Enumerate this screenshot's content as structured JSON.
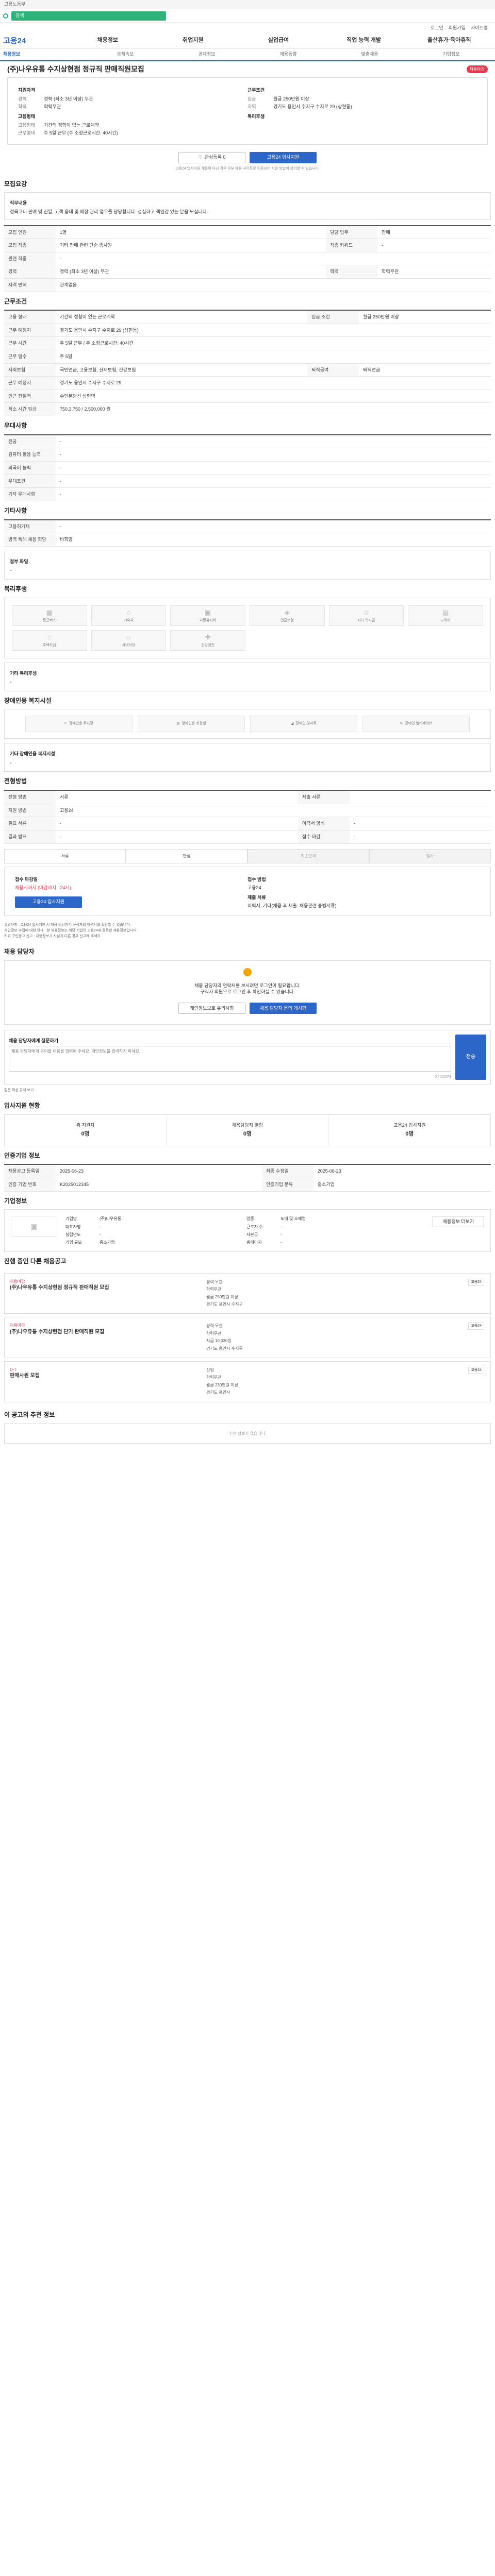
{
  "header": {
    "top_text": "고용노동부",
    "search_text": "검색",
    "util": [
      "로그인",
      "회원가입",
      "사이트맵"
    ],
    "logo": "고용24",
    "gnb": [
      "채용정보",
      "취업지원",
      "실업급여",
      "직업 능력 개발",
      "출산휴가·육아휴직"
    ],
    "subnav": [
      "채용정보",
      "공채속보",
      "공채정보",
      "채용동향",
      "맞춤채용",
      "기업정보"
    ]
  },
  "job": {
    "title": "(주)나우유통 수지상현점 정규직 판매직원모집",
    "badge": "채용마감",
    "left_label": "지원자격",
    "left": [
      {
        "k": "경력",
        "v": "경력 (최소 3년 이상) 무관"
      },
      {
        "k": "학력",
        "v": "학력무관"
      }
    ],
    "left_label2": "고용형태",
    "left2": [
      {
        "k": "고용형태",
        "v": "기간의 정함이 없는 근로계약"
      },
      {
        "k": "근무형태",
        "v": "주 5일 근무 (주 소정근로시간: 40시간)"
      }
    ],
    "right_label": "근무조건",
    "right": [
      {
        "k": "임금",
        "v": "월급 250만원 이상"
      },
      {
        "k": "지역",
        "v": "경기도 용인시 수지구 수지로 29 (상현동)"
      }
    ],
    "right_label2": "복리후생",
    "interest": "관심등록 0",
    "apply_btn": "고용24 입사지원",
    "notice_small": "고용24 입사지원 채용이 아닌 경우 외부 채용 사이트로 이동되어 지원 방법이 상이할 수 있습니다."
  },
  "recruit": {
    "title": "모집요강",
    "desc_label": "직무내용",
    "desc": "정육코너 판매 및 진열, 고객 응대 및 매장 관리 업무를 담당합니다. 성실하고 책임감 있는 분을 모십니다.",
    "rows": [
      [
        "모집 인원",
        "1명",
        "담당 업무",
        "판매"
      ],
      [
        "모집 직종",
        "기타 판매 관련 단순 종사원",
        "직종 키워드",
        "-"
      ],
      [
        "관련 직종",
        "-",
        "",
        ""
      ],
      [
        "경력",
        "경력 (최소 3년 이상) 무관",
        "학력",
        "학력무관"
      ],
      [
        "자격 면허",
        "관계없음",
        "",
        ""
      ]
    ]
  },
  "work": {
    "title": "근무조건",
    "rows": [
      [
        "고용 형태",
        "기간의 정함이 없는 근로계약",
        "임금 조건",
        "월급 250만원 이상"
      ],
      [
        "근무 예정지",
        "경기도 용인시 수지구 수지로 29 (상현동)",
        "",
        ""
      ],
      [
        "근무 시간",
        "주 5일 근무 / 주 소정근로시간: 40시간",
        "",
        ""
      ],
      [
        "근무 일수",
        "주 5일",
        "",
        ""
      ],
      [
        "사회보험",
        "국민연금, 고용보험, 산재보험, 건강보험",
        "퇴직급여",
        "퇴직연금"
      ],
      [
        "근무 예정지",
        "경기도 용인시 수지구 수지로 29",
        "",
        ""
      ],
      [
        "인근 전철역",
        "수인분당선 상현역",
        "",
        ""
      ],
      [
        "최소 시간 임금",
        "750,3,750 / 2,500,000 원",
        "",
        ""
      ]
    ]
  },
  "prefer": {
    "title": "우대사항",
    "rows": [
      [
        "전공",
        "-"
      ],
      [
        "컴퓨터 활용 능력",
        "-"
      ],
      [
        "외국어 능력",
        "-"
      ],
      [
        "우대조건",
        "-"
      ],
      [
        "기타 우대사항",
        "-"
      ]
    ]
  },
  "etc": {
    "title": "기타사항",
    "rows": [
      [
        "고용허가제",
        "-"
      ],
      [
        "병역 특례 채용 희망",
        "비희망"
      ]
    ],
    "attach": "첨부 파일",
    "attach_v": "-"
  },
  "welfare": {
    "title": "복리후생",
    "items": [
      "통근버스",
      "기숙사",
      "차량유지비",
      "연금보험",
      "자녀 학자금",
      "교육비",
      "주택자금",
      "사내식당",
      "건강검진"
    ],
    "other_label": "기타 복리후생",
    "other": "-"
  },
  "disability": {
    "title": "장애인용 복지시설",
    "items": [
      "장애인용 주차장",
      "장애인용 화장실",
      "장애인 경사로",
      "장애인 엘리베이터"
    ],
    "other_label": "기타 장애인용 복지시설",
    "other": "-"
  },
  "apply_method": {
    "title": "전형방법",
    "rows": [
      [
        "전형 방법",
        "서류",
        "제출 서류",
        ""
      ],
      [
        "지원 방법",
        "고용24",
        "",
        ""
      ],
      [
        "필요 서류",
        "-",
        "이력서 양식",
        "-"
      ],
      [
        "결과 발표",
        "-",
        "접수 마감",
        "-"
      ]
    ],
    "steps": [
      "서류",
      "면접",
      "최종합격",
      "입사"
    ],
    "deadline_label": "접수 마감일",
    "deadline": "채용시까지 (마감까지 : 24시)",
    "method_label": "접수 방법",
    "method": "고용24",
    "apply_btn": "고용24 입사지원",
    "docs_label": "제출 서류",
    "docs": "이력서, 기타(채용 후 제출: 채용관련 증빙서류)",
    "notes": [
      "유의사항 : 고용24 입사지원 시 채용 담당자가 구직자의 이력서를 확인할 수 있습니다.",
      "개인정보 수집에 대한 안내 : 본 채용정보는 해당 기업이 고용24에 등록한 채용정보입니다.",
      "허위 구인광고 신고 : 채용정보가 사실과 다른 경우 신고해 주세요."
    ]
  },
  "manager": {
    "title": "채용 담당자",
    "msg1": "채용 담당자의 연락처를 보시려면 로그인이 필요합니다.",
    "msg2": "구직자 회원으로 로그인 후 확인하실 수 있습니다.",
    "btn1": "개인정보보호 유의사항",
    "btn2": "채용 담당자 문의 게시판"
  },
  "inquiry": {
    "title": "채용 담당자에게 질문하기",
    "placeholder": "채용 담당자에게 문의할 내용을 입력해 주세요. 개인정보를 입력하지 마세요.",
    "count": "0 / 1000자",
    "submit": "전송",
    "hint": "질문 작성 규칙 보기"
  },
  "stats": {
    "title": "입사지원 현황",
    "items": [
      {
        "k": "총 지원자",
        "v": "0명"
      },
      {
        "k": "채용담당자 열람",
        "v": "0명"
      },
      {
        "k": "고용24 입사지원",
        "v": "0명"
      }
    ]
  },
  "info": {
    "title": "인증기업 정보",
    "rows": [
      [
        "채용공고 등록일",
        "2025-06-23",
        "최종 수정일",
        "2025-06-23"
      ],
      [
        "인증 기업 번호",
        "K2025012345",
        "인증기업 분류",
        "중소기업"
      ]
    ]
  },
  "company": {
    "title": "기업정보",
    "btn": "채용정보 더보기",
    "rows": [
      [
        "기업명",
        "(주)나우유통",
        "업종",
        "도매 및 소매업"
      ],
      [
        "대표자명",
        "-",
        "근로자 수",
        "-"
      ],
      [
        "설립년도",
        "-",
        "자본금",
        "-"
      ],
      [
        "기업 규모",
        "중소기업",
        "홈페이지",
        "-"
      ]
    ]
  },
  "other_jobs": {
    "title": "진행 중인 다른 채용공고",
    "jobs": [
      {
        "d": "채용마감",
        "t": "(주)나우유통 수지상현점 정규직 판매직원 모집",
        "m": [
          "경력 무관",
          "학력무관",
          "월급 250만원 이상",
          "경기도 용인시 수지구"
        ],
        "r": "고용24"
      },
      {
        "d": "채용마감",
        "t": "(주)나우유통 수지상현점 단기 판매직원 모집",
        "m": [
          "경력 무관",
          "학력무관",
          "시급 10,030원",
          "경기도 용인시 수지구"
        ],
        "r": "고용24"
      },
      {
        "d": "D-7",
        "t": "판매사원 모집",
        "m": [
          "신입",
          "학력무관",
          "월급 230만원 이상",
          "경기도 용인시"
        ],
        "r": "고용24"
      }
    ]
  },
  "footer_sec": {
    "title": "이 공고의 추천 정보",
    "text": "추천 정보가 없습니다."
  },
  "colors": {
    "brand": "#2c66c8",
    "accent": "#2eb37a",
    "danger": "#e8384f"
  }
}
